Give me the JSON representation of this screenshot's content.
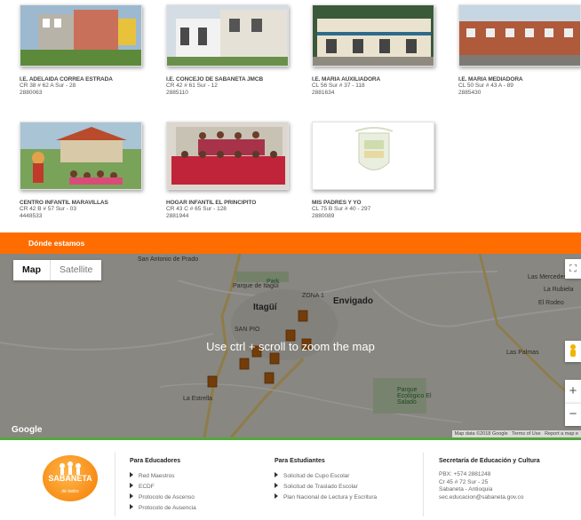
{
  "schools": [
    {
      "name": "I.E. ADELAIDA CORREA ESTRADA",
      "address": "CR 38 # 62 A Sur - 28",
      "phone": "2880063"
    },
    {
      "name": "I.E. CONCEJO DE SABANETA JMCB",
      "address": "CR 42 # 61 Sur - 12",
      "phone": "2885110"
    },
    {
      "name": "I.E. MARIA AUXILIADORA",
      "address": "CL 56 Sur # 37 - 118",
      "phone": "2881634"
    },
    {
      "name": "I.E. MARIA MEDIADORA",
      "address": "CL 50 Sur # 43 A - 89",
      "phone": "2885430"
    },
    {
      "name": "CENTRO INFANTIL MARAVILLAS",
      "address": "CR 42 B # 57 Sur - 03",
      "phone": "4448533"
    },
    {
      "name": "HOGAR INFANTIL EL PRINCIPITO",
      "address": "CR 43 C # 65 Sur - 128",
      "phone": "2881944"
    },
    {
      "name": "MIS PADRES Y YO",
      "address": "CL 75 B Sur # 40 - 297",
      "phone": "2880089"
    }
  ],
  "location_section": {
    "title": "Dónde estamos"
  },
  "map": {
    "type_map": "Map",
    "type_satellite": "Satellite",
    "zoom_message": "Use ctrl + scroll to zoom the map",
    "labels": {
      "san_antonio": "San Antonio de Prado",
      "park_itagui": "Parque de Itagüí",
      "itagui": "Itagüí",
      "envigado": "Envigado",
      "zona1": "ZONA 1",
      "sanpio": "SAN PIO",
      "estrella": "La Estrella",
      "mercedes": "Las Mercedes",
      "rubiela": "La Rubiela",
      "rodeo": "El Rodeo",
      "palmas": "Las Palmas",
      "park_el_salado": "Parque Ecológico El Salado",
      "park": "Park"
    },
    "google": "Google",
    "attribution": "Map data ©2018 Google   Terms of Use   Report a map e",
    "zoom_in": "+",
    "zoom_out": "−",
    "fullscreen": "⛶"
  },
  "footer": {
    "logo_line1": "SABANETA",
    "logo_line2": "de todos",
    "educadores": {
      "title": "Para Educadores",
      "items": [
        "Red Maestros",
        "ECDF",
        "Protocolo de Ascenso",
        "Protocolo de Ausencia"
      ]
    },
    "estudiantes": {
      "title": "Para Estudiantes",
      "items": [
        "Solicitud de Cupo Escolar",
        "Solicitud de Traslado Escolar",
        "Plan Nacional de Lectura y Escritura"
      ]
    },
    "secretaria": {
      "title": "Secretaría de Educación y Cultura",
      "lines": [
        "PBX: +574 2881248",
        "Cr 45 # 72 Sur - 25",
        "Sabaneta - Antioquia",
        "sec.educacion@sabaneta.gov.co"
      ]
    }
  }
}
